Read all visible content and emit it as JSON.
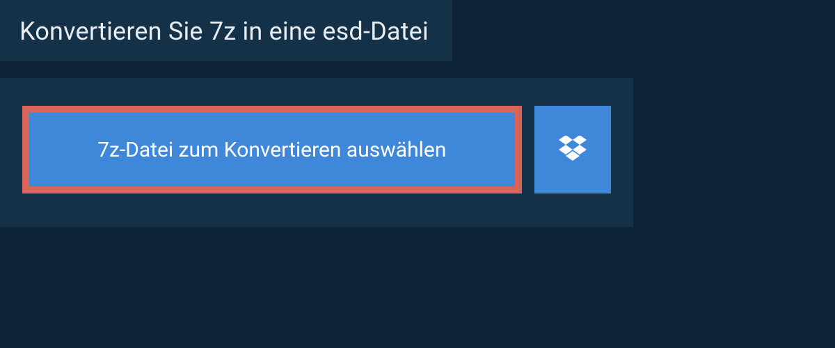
{
  "page": {
    "title": "Konvertieren Sie 7z in eine esd-Datei"
  },
  "actions": {
    "pick_file_label": "7z-Datei zum Konvertieren auswählen",
    "dropbox_icon": "dropbox-icon"
  },
  "colors": {
    "bg": "#0d2438",
    "panel": "#153147",
    "primary": "#3f87d9",
    "highlight_border": "#d96459",
    "text": "#e7edf2"
  }
}
